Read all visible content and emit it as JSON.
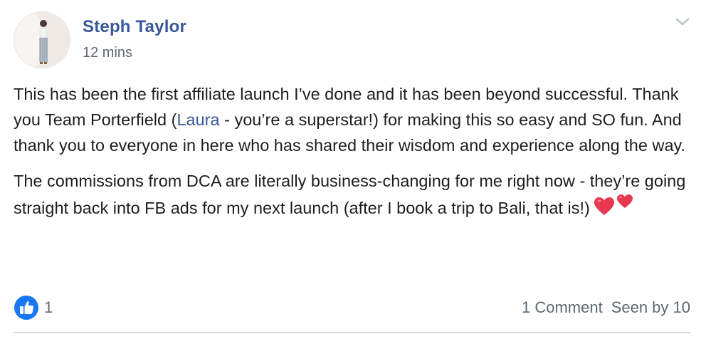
{
  "post": {
    "author": "Steph Taylor",
    "timestamp": "12 mins",
    "paragraph1_a": "This has been the first affiliate launch I’ve done and it has been beyond successful. Thank you Team Porterfield (",
    "mention": "Laura",
    "paragraph1_b": " - you’re a superstar!) for making this so easy and SO fun. And thank you to everyone in here who has shared their wisdom and experience along the way.",
    "paragraph2": "The commissions from DCA are literally business-changing for me right now - they’re going straight back into FB ads for my next launch (after I book a trip to Bali, that is!)",
    "emoji": "two-hearts-emoji"
  },
  "footer": {
    "like_count": "1",
    "comments": "1 Comment",
    "seen_by": "Seen by 10"
  },
  "icons": {
    "avatar": "profile-photo",
    "menu": "chevron-down-icon",
    "like": "thumbs-up-icon"
  },
  "colors": {
    "name": "#385898",
    "link": "#385898",
    "meta": "#616770",
    "like_badge": "#1877f2",
    "hearts": "#e8384f"
  }
}
